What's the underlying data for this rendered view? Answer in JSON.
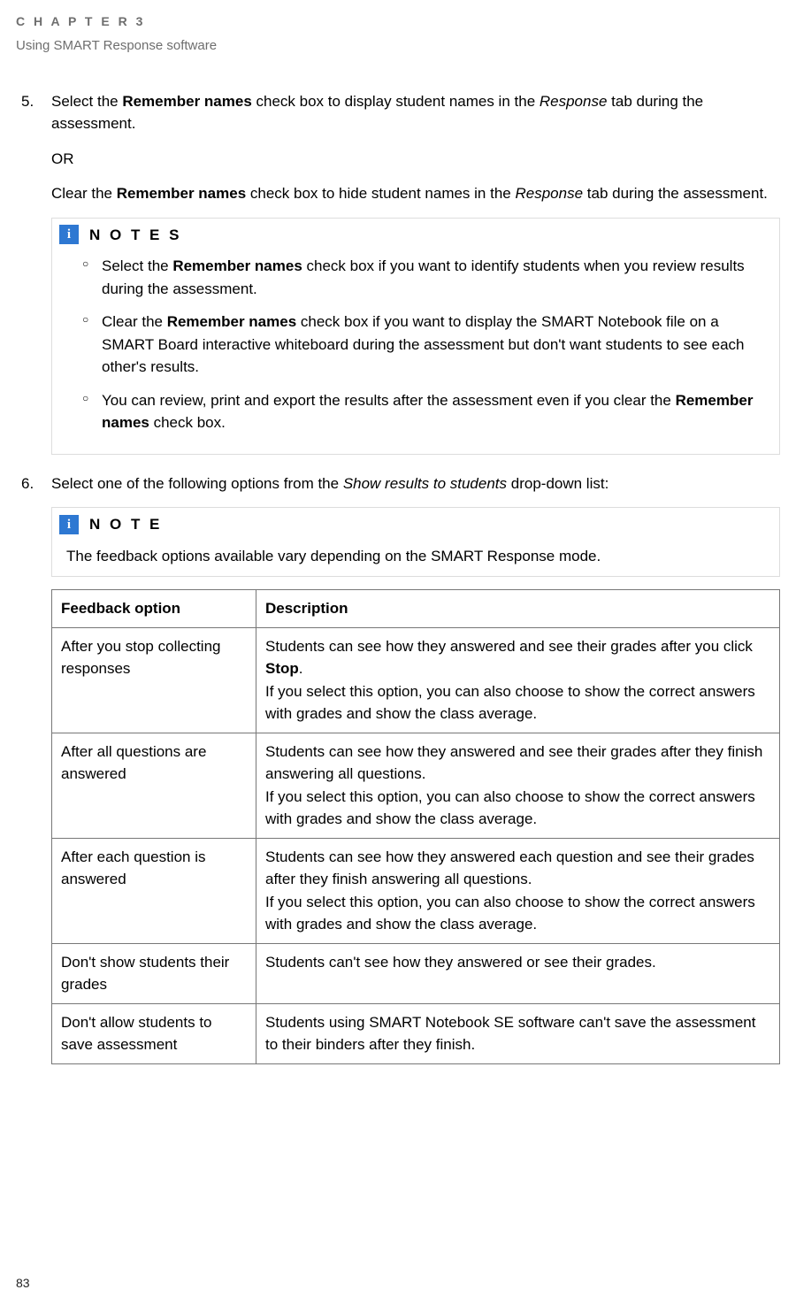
{
  "header": {
    "chapter_label": "C H A P T E R  3",
    "subtitle": "Using SMART Response software"
  },
  "step5": {
    "num": "5.",
    "text_a1": "Select the ",
    "text_a_bold": "Remember names",
    "text_a2": " check box to display student names in the ",
    "text_a_ital": "Response",
    "text_a3": " tab during the assessment.",
    "or": "OR",
    "text_b1": "Clear the ",
    "text_b_bold": "Remember names",
    "text_b2": " check box to hide student names in the ",
    "text_b_ital": "Response",
    "text_b3": " tab during the assessment."
  },
  "notes_block": {
    "icon": "i",
    "title": "N O T E S",
    "items": [
      {
        "p1": "Select the ",
        "b": "Remember names",
        "p2": " check box if you want to identify students when you review results during the assessment."
      },
      {
        "p1": "Clear the ",
        "b": "Remember names",
        "p2": " check box if you want to display the SMART Notebook file on a SMART Board interactive whiteboard during the assessment but don't want students to see each other's results."
      },
      {
        "p1": "You can review, print and export the results after the assessment even if you clear the ",
        "b": "Remember names",
        "p2": " check box."
      }
    ]
  },
  "step6": {
    "num": "6.",
    "p1": "Select one of the following options from the ",
    "ital": "Show results to students",
    "p2": " drop-down list:"
  },
  "note_block": {
    "icon": "i",
    "title": "N O T E",
    "body": "The feedback options available vary depending on the SMART Response mode."
  },
  "table": {
    "head": {
      "opt": "Feedback option",
      "desc": "Description"
    },
    "rows": [
      {
        "opt": "After you stop collecting responses",
        "d1a": "Students can see how they answered and see their grades after you click ",
        "d1b": "Stop",
        "d1c": ".",
        "d2": "If you select this option, you can also choose to show the correct answers with grades and show the class average."
      },
      {
        "opt": "After all questions are answered",
        "d1a": "Students can see how they answered and see their grades after they finish answering all questions.",
        "d1b": "",
        "d1c": "",
        "d2": "If you select this option, you can also choose to show the correct answers with grades and show the class average."
      },
      {
        "opt": "After each question is answered",
        "d1a": "Students can see how they answered each question and see their grades after they finish answering all questions.",
        "d1b": "",
        "d1c": "",
        "d2": "If you select this option, you can also choose to show the correct answers with grades and show the class average."
      },
      {
        "opt": "Don't show students their grades",
        "d1a": "Students can't see how they answered or see their grades.",
        "d1b": "",
        "d1c": "",
        "d2": ""
      },
      {
        "opt": "Don't allow students to save assessment",
        "d1a": "Students using SMART Notebook SE software can't save the assessment to their binders after they finish.",
        "d1b": "",
        "d1c": "",
        "d2": ""
      }
    ]
  },
  "page_number": "83"
}
